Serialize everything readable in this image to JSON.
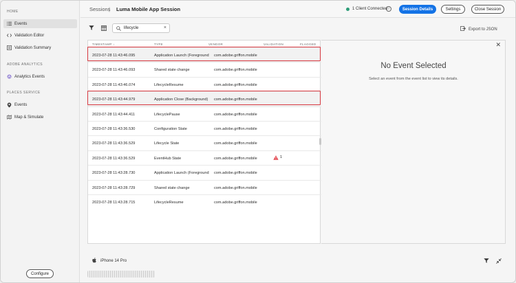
{
  "sidebar": {
    "home_heading": "HOME",
    "home_items": [
      {
        "label": "Events",
        "icon": "list-icon"
      },
      {
        "label": "Validation Editor",
        "icon": "code-icon"
      },
      {
        "label": "Validation Summary",
        "icon": "summary-icon"
      }
    ],
    "analytics_heading": "ADOBE ANALYTICS",
    "analytics_items": [
      {
        "label": "Analytics Events",
        "icon": "analytics-icon"
      }
    ],
    "places_heading": "PLACES SERVICE",
    "places_items": [
      {
        "label": "Events",
        "icon": "pin-icon"
      },
      {
        "label": "Map & Simulate",
        "icon": "map-icon"
      }
    ],
    "configure_label": "Configure"
  },
  "header": {
    "breadcrumb_root": "Sessions",
    "breadcrumb_separator": "|",
    "session_title": "Luma Mobile App Session",
    "connection_status": "1 Client Connected",
    "session_details_label": "Session Details",
    "settings_label": "Settings",
    "close_session_label": "Close Session"
  },
  "toolbar": {
    "search_value": "lifecycle",
    "export_label": "Export to JSON"
  },
  "table": {
    "columns": [
      "TIMESTAMP",
      "TYPE",
      "VENDOR",
      "VALIDATION",
      "FLAGGED"
    ],
    "sort_indicator": "↓",
    "rows": [
      {
        "timestamp": "2023-07-28 11:43:46.095",
        "type": "Application Launch (Foreground)",
        "vendor": "com.adobe.griffon.mobile",
        "validation": "",
        "highlighted": true
      },
      {
        "timestamp": "2023-07-28 11:43:46.093",
        "type": "Shared state change",
        "vendor": "com.adobe.griffon.mobile",
        "validation": ""
      },
      {
        "timestamp": "2023-07-28 11:43:46.074",
        "type": "LifecycleResume",
        "vendor": "com.adobe.griffon.mobile",
        "validation": ""
      },
      {
        "timestamp": "2023-07-28 11:43:44.979",
        "type": "Application Close (Background)",
        "vendor": "com.adobe.griffon.mobile",
        "validation": "",
        "highlighted": true
      },
      {
        "timestamp": "2023-07-28 11:43:44.411",
        "type": "LifecyclePause",
        "vendor": "com.adobe.griffon.mobile",
        "validation": ""
      },
      {
        "timestamp": "2023-07-28 11:43:36.530",
        "type": "Configuration State",
        "vendor": "com.adobe.griffon.mobile",
        "validation": ""
      },
      {
        "timestamp": "2023-07-28 11:43:36.529",
        "type": "Lifecycle State",
        "vendor": "com.adobe.griffon.mobile",
        "validation": ""
      },
      {
        "timestamp": "2023-07-28 11:43:36.529",
        "type": "EventHub State",
        "vendor": "com.adobe.griffon.mobile",
        "validation": "1"
      },
      {
        "timestamp": "2023-07-28 11:43:28.730",
        "type": "Application Launch (Foreground)",
        "vendor": "com.adobe.griffon.mobile",
        "validation": ""
      },
      {
        "timestamp": "2023-07-28 11:43:28.729",
        "type": "Shared state change",
        "vendor": "com.adobe.griffon.mobile",
        "validation": ""
      },
      {
        "timestamp": "2023-07-28 11:43:28.715",
        "type": "LifecycleResume",
        "vendor": "com.adobe.griffon.mobile",
        "validation": ""
      }
    ]
  },
  "detail": {
    "title": "No Event Selected",
    "subtitle": "Select an event from the event list to view its details."
  },
  "footer": {
    "device_name": "iPhone 14 Pro"
  },
  "colors": {
    "accent": "#1473e6",
    "connected": "#2d9d78",
    "highlight": "#d7373f",
    "warning": "#e34850"
  }
}
